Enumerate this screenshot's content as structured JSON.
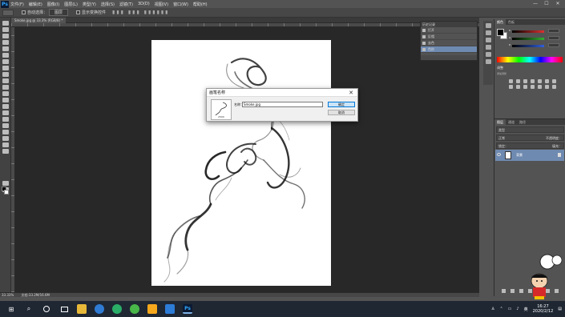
{
  "app": {
    "name": "Photoshop",
    "logo_text": "Ps",
    "menu": [
      "文件(F)",
      "编辑(E)",
      "图像(I)",
      "图层(L)",
      "类型(Y)",
      "选择(S)",
      "滤镜(T)",
      "3D(D)",
      "视图(V)",
      "窗口(W)",
      "帮助(H)"
    ],
    "window_controls": [
      "—",
      "☐",
      "✕"
    ]
  },
  "options_bar": {
    "auto_select_label": "自动选择：",
    "auto_select_value": "图层",
    "transform_label": "显示变换控件"
  },
  "document": {
    "tab_title": "Smoke.jpg @ 33.3% (RGB/8) *",
    "zoom": "33.33%",
    "doc_info": "文档:33.2M/16.6M"
  },
  "dialog": {
    "title": "画笔名称",
    "close": "✕",
    "thumb_size": "2500",
    "name_label": "名称：",
    "name_value": "Smoke.jpg",
    "ok_label": "确定",
    "cancel_label": "取消"
  },
  "history_panel": {
    "title": "历史记录",
    "items": [
      "打开",
      "反相",
      "去色",
      "色阶"
    ],
    "selected_index": 3
  },
  "right_dock": {
    "color_tabs": [
      "颜色",
      "色板"
    ],
    "sliders": [
      {
        "label": "R",
        "color": "#e03030"
      },
      {
        "label": "G",
        "color": "#30b030"
      },
      {
        "label": "B",
        "color": "#3060e0"
      }
    ],
    "adjust_title": "调整",
    "adjust_subtitle": "添加调整",
    "layers_tabs": [
      "图层",
      "通道",
      "路径"
    ],
    "kind_label": "类型",
    "blend_mode": "正常",
    "opacity_label": "不透明度：",
    "lock_label": "锁定：",
    "fill_label": "填充：",
    "layer_name": "背景"
  },
  "taskbar": {
    "time": "16:27",
    "date": "2020/2/12",
    "ime": "英",
    "start_icon": "⊞",
    "search_icon": "⌕"
  }
}
